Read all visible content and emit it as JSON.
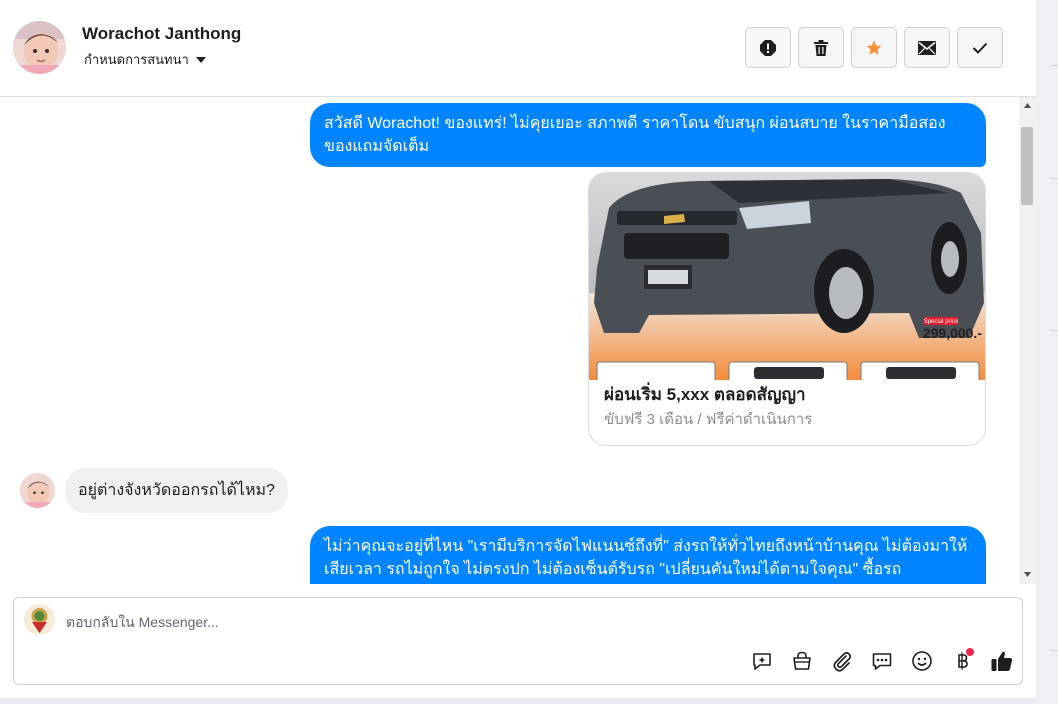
{
  "header": {
    "contact_name": "Worachot Janthong",
    "assign_label": "กำหนดการสนทนา",
    "actions": [
      {
        "name": "mark-spam-button",
        "icon": "alert-circle-icon"
      },
      {
        "name": "delete-button",
        "icon": "trash-icon"
      },
      {
        "name": "star-button",
        "icon": "star-icon",
        "color": "#f7923b"
      },
      {
        "name": "mark-unread-button",
        "icon": "envelope-icon"
      },
      {
        "name": "mark-done-button",
        "icon": "checkmark-icon"
      }
    ]
  },
  "messages": {
    "outgoing_1": "สวัสดี Worachot! ของแทร่! ไม่คุยเยอะ สภาพดี ราคาโดน ขับสนุก ผ่อนสบาย ในราคามือสอง ของแถมจัดเต็ม",
    "card": {
      "title": "ผ่อนเริ่ม 5,xxx ตลอดสัญญา",
      "subtitle": "ขับฟรี 3 เดือน / ฟรีค่าดำเนินการ",
      "image_badge": "Special price",
      "image_price": "299,000.-"
    },
    "incoming_1": "อยู่ต่างจังหวัดออกรถได้ไหม?",
    "outgoing_2": "ไม่ว่าคุณจะอยู่ที่ไหน \"เรามีบริการจัดไฟแนนซ์ถึงที่\"  ส่งรถให้ทั่วไทยถึงหน้าบ้านคุณ ไม่ต้องมาให้เสียเวลา รถไม่ถูกใจ ไม่ตรงปก ไม่ต้องเซ็นต์รับรถ \"เปลี่ยนคันใหม่ได้ตามใจคุณ\" ซื้อรถ"
  },
  "composer": {
    "placeholder": "ตอบกลับใน Messenger...",
    "tools": [
      "sparkle-chat-icon",
      "shopping-bag-icon",
      "paperclip-icon",
      "chat-bubble-icon",
      "emoji-icon",
      "baht-icon",
      "thumbs-up-icon"
    ],
    "accent": "#0084ff"
  }
}
